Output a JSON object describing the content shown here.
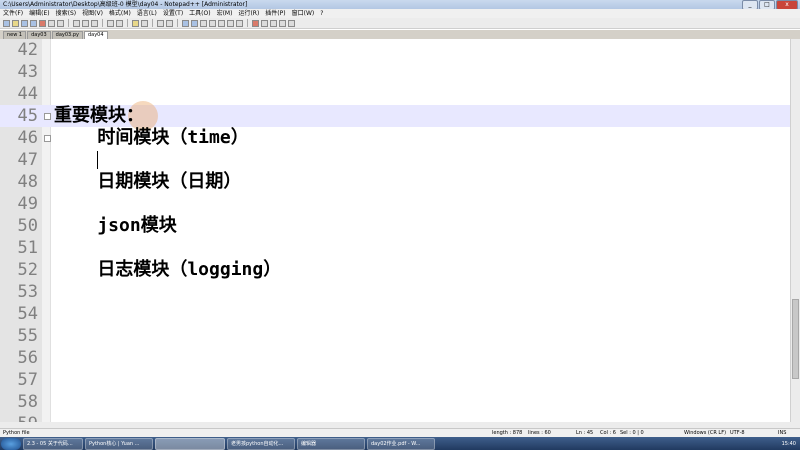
{
  "window": {
    "title": "C:\\Users\\Administrator\\Desktop\\高级班-0 模型\\day04 - Notepad++ [Administrator]",
    "controls": [
      "_",
      "□",
      "x"
    ]
  },
  "menu": [
    "文件(F)",
    "编辑(E)",
    "搜索(S)",
    "视图(V)",
    "格式(M)",
    "语言(L)",
    "设置(T)",
    "工具(O)",
    "宏(M)",
    "运行(R)",
    "插件(P)",
    "窗口(W)",
    "?"
  ],
  "tabs": [
    "new 1",
    "day03",
    "day03.py",
    "day04"
  ],
  "active_tab_index": 3,
  "editor": {
    "lines": [
      {
        "n": "42",
        "text": ""
      },
      {
        "n": "43",
        "text": ""
      },
      {
        "n": "44",
        "text": ""
      },
      {
        "n": "45",
        "text": "重要模块："
      },
      {
        "n": "46",
        "text": "    时间模块（time）"
      },
      {
        "n": "47",
        "text": ""
      },
      {
        "n": "48",
        "text": "    日期模块（日期）"
      },
      {
        "n": "49",
        "text": ""
      },
      {
        "n": "50",
        "text": "    json模块"
      },
      {
        "n": "51",
        "text": ""
      },
      {
        "n": "52",
        "text": "    日志模块（logging）"
      },
      {
        "n": "53",
        "text": ""
      },
      {
        "n": "54",
        "text": ""
      },
      {
        "n": "55",
        "text": ""
      },
      {
        "n": "56",
        "text": ""
      },
      {
        "n": "57",
        "text": ""
      },
      {
        "n": "58",
        "text": ""
      },
      {
        "n": "59",
        "text": ""
      }
    ],
    "current_line": "45"
  },
  "status": {
    "file_type": "Python file",
    "length": "length : 878",
    "lines": "lines : 60",
    "ln": "Ln : 45",
    "col": "Col : 6",
    "sel": "Sel : 0 | 0",
    "eol": "Windows (CR LF)",
    "encoding": "UTF-8",
    "mode": "INS"
  },
  "taskbar": {
    "items": [
      "2.3 - 05 关于代码...",
      "Python核心 | Yuan ...",
      "",
      "老男孩python自动化...",
      "编辑器",
      "day02作业.pdf - W..."
    ],
    "time": "15:40"
  },
  "colors": {
    "current_line": "#e8e8ff",
    "gutter": "#e4e4e4",
    "line_number": "#808080"
  }
}
